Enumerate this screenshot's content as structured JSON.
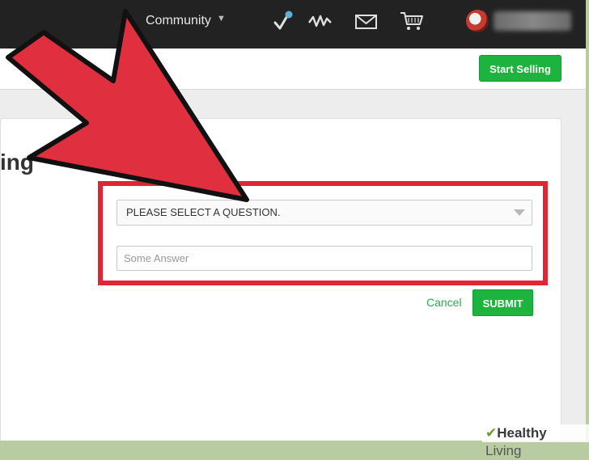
{
  "nav": {
    "community_label": "Community",
    "caret": "▼",
    "icons": [
      "pin-check-icon",
      "activity-icon",
      "mail-icon",
      "cart-icon"
    ]
  },
  "header": {
    "start_selling_label": "Start Selling"
  },
  "panel": {
    "heading_fragment": "ing"
  },
  "form": {
    "question_select_value": "PLEASE SELECT A QUESTION.",
    "answer_placeholder": "Some Answer",
    "cancel_label": "Cancel",
    "submit_label": "SUBMIT"
  },
  "watermark": {
    "check": "✔",
    "word1": "Healthy",
    "word2": "Living"
  },
  "colors": {
    "topbar": "#222222",
    "accent_green": "#1db33f",
    "highlight_red": "#e02534",
    "arrow_red": "#e03040"
  }
}
